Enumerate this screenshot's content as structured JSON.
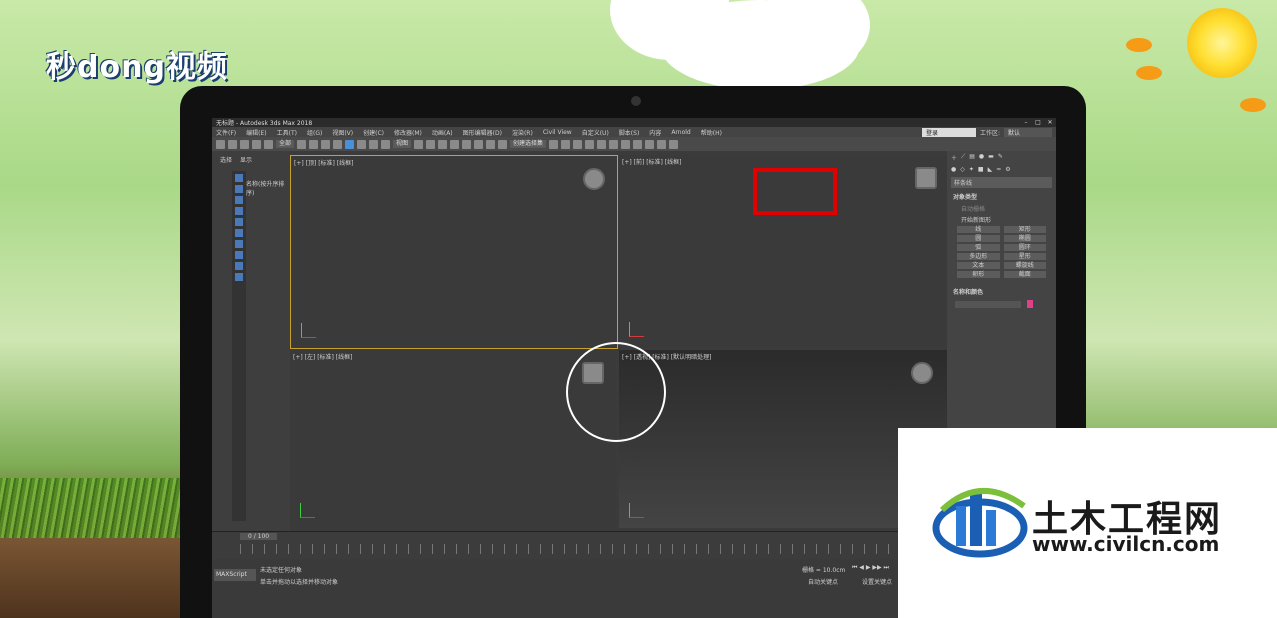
{
  "watermark_top_left": "秒dong视频",
  "app": {
    "title": "无标题 - Autodesk 3ds Max 2018",
    "menu": [
      "文件(F)",
      "编辑(E)",
      "工具(T)",
      "组(G)",
      "视图(V)",
      "创建(C)",
      "修改器(M)",
      "动画(A)",
      "图形编辑器(D)",
      "渲染(R)",
      "Civil View",
      "自定义(U)",
      "脚本(S)",
      "内容",
      "Arnold",
      "帮助(H)"
    ],
    "user_box": "登录",
    "workspace_label": "工作区:",
    "workspace_value": "默认",
    "toolbar": {
      "selection_filter": "全部",
      "view_dropdown": "视图",
      "named_selection": "创建选择集"
    },
    "scene_explorer": {
      "tab_select": "选择",
      "tab_display": "显示",
      "sort_label": "名称(按升序排序)"
    },
    "viewports": {
      "top": "[+] [顶] [标准] [线框]",
      "front": "[+] [前] [标准] [线框]",
      "left": "[+] [左] [标准] [线框]",
      "perspective": "[+] [透视] [标准] [默认明暗处理]"
    },
    "command_panel": {
      "category": "样条线",
      "rollout_object_type": "对象类型",
      "autogrid": "自动栅格",
      "start_new_shape": "开始新图形",
      "buttons": [
        [
          "线",
          "矩形"
        ],
        [
          "圆",
          "椭圆"
        ],
        [
          "弧",
          "圆环"
        ],
        [
          "多边形",
          "星形"
        ],
        [
          "文本",
          "螺旋线"
        ],
        [
          "卵形",
          "截面"
        ]
      ],
      "rollout_name_color": "名称和颜色"
    },
    "timeline": {
      "frame": "0 / 100"
    },
    "status": {
      "maxscript": "MAXScript",
      "line1": "未选定任何对象",
      "line2": "单击并拖动以选择并移动对象",
      "grid": "栅格 = 10.0cm",
      "autokey": "自动关键点",
      "setkey": "设置关键点"
    }
  },
  "watermark_bottom_right": {
    "cn": "土木工程网",
    "url": "www.civilcn.com"
  },
  "colors": {
    "highlight_box": "#e00000",
    "viewport_active_border": "#c8a02a",
    "name_color_swatch": "#e0408a"
  }
}
